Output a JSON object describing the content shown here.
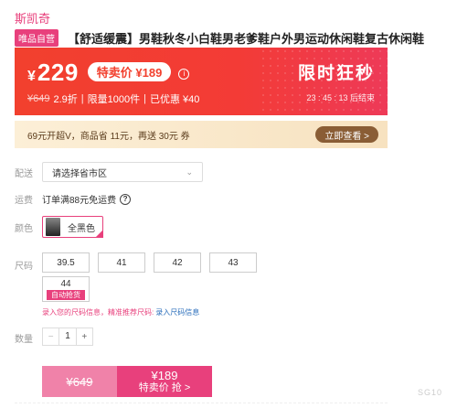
{
  "brand": "斯凯奇",
  "title_bar": {
    "store_badge": "唯品自营",
    "title": "【舒适缓震】男鞋秋冬小白鞋男老爹鞋户外男运动休闲鞋复古休闲鞋"
  },
  "price_banner": {
    "currency": "¥",
    "price": "229",
    "special_label": "特卖价 ¥189",
    "original_price": "¥649",
    "discount": "2.9折",
    "limit": "限量1000件",
    "saved": "已优惠 ¥40",
    "flash_title": "限时狂秒",
    "countdown": "23 : 45 : 13 后结束"
  },
  "vip_banner": {
    "text": "69元开超V，商品省 11元，再送 30元 券",
    "button": "立即查看 >"
  },
  "delivery": {
    "label": "配送",
    "select_value": "请选择省市区",
    "caret": "⌄"
  },
  "shipping": {
    "label": "运费",
    "text": "订单满88元免运费",
    "help": "?"
  },
  "color": {
    "label": "颜色",
    "selected": "全黑色"
  },
  "size": {
    "label": "尺码",
    "options": [
      "39.5",
      "41",
      "42",
      "43",
      "44"
    ],
    "special_tag": "自动抢货",
    "hint": "录入您的尺码信息，精准推荐尺码:",
    "hint_link": "录入尺码信息"
  },
  "quantity": {
    "label": "数量",
    "minus": "−",
    "value": "1",
    "plus": "+"
  },
  "buy": {
    "original": "¥649",
    "price": "¥189",
    "action": "特卖价 抢 >"
  },
  "watermark": "SG10"
}
